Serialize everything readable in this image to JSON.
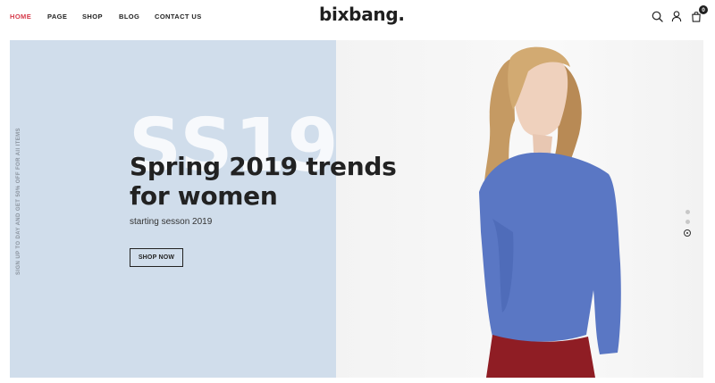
{
  "nav": {
    "items": [
      {
        "label": "HOME",
        "active": true
      },
      {
        "label": "PAGE"
      },
      {
        "label": "SHOP"
      },
      {
        "label": "BLOG"
      },
      {
        "label": "CONTACT US"
      }
    ],
    "active_color": "#d63a4a"
  },
  "brand": {
    "logo": "bixbang."
  },
  "header_icons": {
    "search": "search-icon",
    "account": "user-icon",
    "cart": "bag-icon",
    "cart_count": "0"
  },
  "hero": {
    "side_text": "SIGN UP TO DAY AND GET 50% OFF FOR All ITEMS",
    "bg_word": "SS19",
    "headline_line1": "Spring 2019 trends",
    "headline_line2": "for women",
    "subline": "starting sesson 2019",
    "cta_label": "SHOP NOW",
    "left_bg": "#d0ddeb",
    "slides": 3,
    "active_slide": 3
  }
}
